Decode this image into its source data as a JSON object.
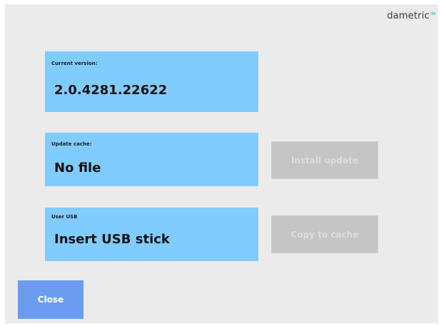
{
  "brand": {
    "logo_text": "dametric",
    "accent_color": "#7fe3c8"
  },
  "version": {
    "label": "Current version:",
    "value": "2.0.4281.22622"
  },
  "cache": {
    "label": "Update cache:",
    "value": "No file"
  },
  "usb": {
    "label": "User USB",
    "value": "Insert USB stick"
  },
  "buttons": {
    "install_update": "Install update",
    "copy_to_cache": "Copy to cache",
    "close": "Close"
  },
  "colors": {
    "panel": "#80ccff",
    "disabled_button": "#c5c5c5",
    "close_button": "#6b9cf0",
    "background": "#ebebeb"
  }
}
